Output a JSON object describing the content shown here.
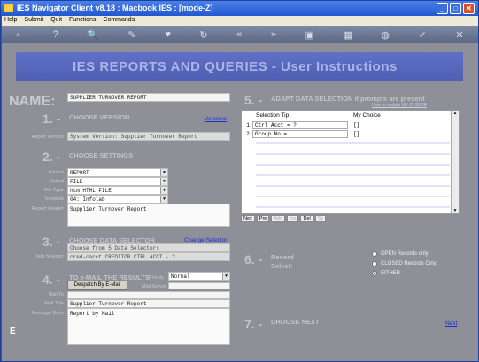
{
  "window": {
    "title": "IES Navigator Client v8.18 : Macbook IES :        [mode-Z]"
  },
  "menu": [
    "Help",
    "Submit",
    "Quit",
    "Functions",
    "Commands"
  ],
  "toolbar": {
    "icons": [
      "exit-icon",
      "help-icon",
      "search-icon",
      "edit-icon",
      "heart-icon",
      "undo-icon",
      "rewind-icon",
      "forward-icon",
      "copy-icon",
      "save-icon",
      "globe-icon",
      "check-icon",
      "close-icon"
    ],
    "glyphs": [
      "⟜",
      "?",
      "🔍",
      "✎",
      "♥",
      "↻",
      "«",
      "»",
      "▣",
      "▦",
      "◍",
      "✓",
      "✕"
    ]
  },
  "banner": "IES REPORTS AND QUERIES  -  User Instructions",
  "name": {
    "label": "NAME:",
    "value": "SUPPLIER TURNOVER REPORT"
  },
  "s1": {
    "num": "1.  -",
    "title": "CHOOSE VERSION",
    "link": "Versions",
    "field_label": "Report Version",
    "value": "System Version: Supplier Turnover Report"
  },
  "s2": {
    "num": "2.  -",
    "title": "CHOOSE SETTINGS",
    "rows": [
      {
        "label": "Format",
        "value": "REPORT"
      },
      {
        "label": "Output",
        "value": "FILE"
      },
      {
        "label": "File Type",
        "value": "htm HTML FILE"
      },
      {
        "label": "Template",
        "value": "04: Infolab"
      }
    ],
    "header_label": "Report Header",
    "header_value": "Supplier Turnover Report"
  },
  "s3": {
    "num": "3.  -",
    "title": "CHOOSE DATA SELECTOR",
    "link": "Change Selector",
    "choose_text": "Choose from 5 Data Selectors",
    "field_label": "Data Selector",
    "value": "cred-cacct CREDITOR CTRL ACCT - ?"
  },
  "s4": {
    "num": "4.  -",
    "title": "TO e-MAIL THE RESULTS",
    "priority_label": "Priority",
    "priority_value": "Normal",
    "button": "Despatch By E-Mail",
    "mail_server_label": "Mail Server",
    "mail_to_label": "Mail To",
    "mail_title_label": "Mail Title",
    "mail_title_value": "Supplier Turnover Report",
    "body_label": "Message Body",
    "body_value": "Report by Mail"
  },
  "s5": {
    "num": "5.  -",
    "title": "ADAPT DATA SELECTION if prompts are present",
    "how_link": "How to update MY CHOICE",
    "columns": [
      "Selection Tip",
      "My Choice"
    ],
    "rows": [
      {
        "n": "1",
        "tip": "Ctrl Acct = ?",
        "choice": "[]"
      },
      {
        "n": "2",
        "tip": "Group No =",
        "choice": "[]"
      }
    ],
    "nav": [
      "Nex",
      "Pre",
      "Add",
      "Ins",
      "Del",
      "Sv"
    ]
  },
  "s6": {
    "num": "6.  -",
    "title1": "Record",
    "title2": "Select:",
    "options": [
      "OPEN Records only",
      "CLOSED Records Only",
      "EITHER"
    ],
    "selected": 2
  },
  "s7": {
    "num": "7.  -",
    "title": "CHOOSE NEXT",
    "link": "Next"
  }
}
